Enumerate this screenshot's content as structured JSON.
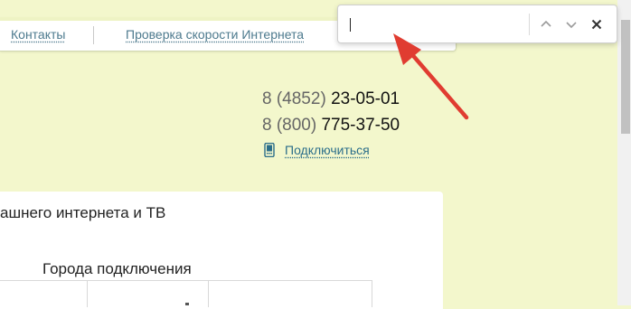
{
  "nav": {
    "contacts": "Контакты",
    "speedtest": "Проверка скорости Интернета"
  },
  "phones": [
    {
      "prefix": "8 (4852)",
      "number": "23-05-01"
    },
    {
      "prefix": "8 (800)",
      "number": "775-37-50"
    }
  ],
  "connect": {
    "label": "Подключиться",
    "icon": "mobile-phone-icon"
  },
  "panel": {
    "heading": "ашнего интернета и ТВ",
    "subheading": "Города подключения"
  },
  "findbar": {
    "value": "",
    "icons": [
      "chevron-up-icon",
      "chevron-down-icon",
      "close-icon"
    ]
  },
  "colors": {
    "page_bg": "#f3f7cc",
    "link": "#2b6e8a",
    "arrow": "#e03c31"
  }
}
